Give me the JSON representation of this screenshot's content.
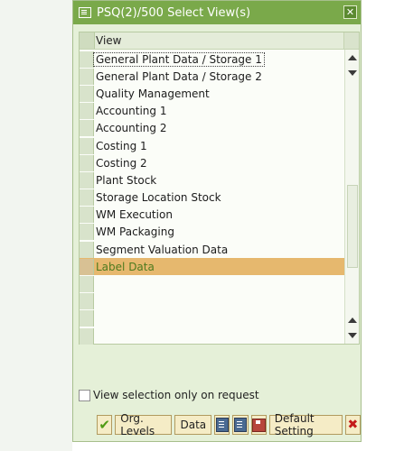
{
  "dialog": {
    "title": "PSQ(2)/500 Select View(s)"
  },
  "table": {
    "column_header": "View",
    "rows": [
      {
        "label": "General Plant Data / Storage 1",
        "selected": false,
        "focused": true
      },
      {
        "label": "General Plant Data / Storage 2",
        "selected": false
      },
      {
        "label": "Quality Management",
        "selected": false
      },
      {
        "label": "Accounting 1",
        "selected": false
      },
      {
        "label": "Accounting 2",
        "selected": false
      },
      {
        "label": "Costing 1",
        "selected": false
      },
      {
        "label": "Costing 2",
        "selected": false
      },
      {
        "label": "Plant Stock",
        "selected": false
      },
      {
        "label": "Storage Location Stock",
        "selected": false
      },
      {
        "label": "WM Execution",
        "selected": false
      },
      {
        "label": "WM Packaging",
        "selected": false
      },
      {
        "label": "Segment Valuation Data",
        "selected": false
      },
      {
        "label": "Label Data",
        "selected": true
      },
      {
        "label": "",
        "selected": false
      },
      {
        "label": "",
        "selected": false
      },
      {
        "label": "",
        "selected": false
      },
      {
        "label": "",
        "selected": false
      }
    ]
  },
  "options": {
    "view_selection_label": "View selection only on request",
    "view_selection_checked": false
  },
  "toolbar": {
    "org_levels_label": "Org. Levels",
    "data_label": "Data",
    "default_setting_label": "Default Setting"
  },
  "colors": {
    "title_bar": "#7aa94a",
    "selected_row": "#e6b86e",
    "dialog_bg": "#e5f0d8"
  }
}
